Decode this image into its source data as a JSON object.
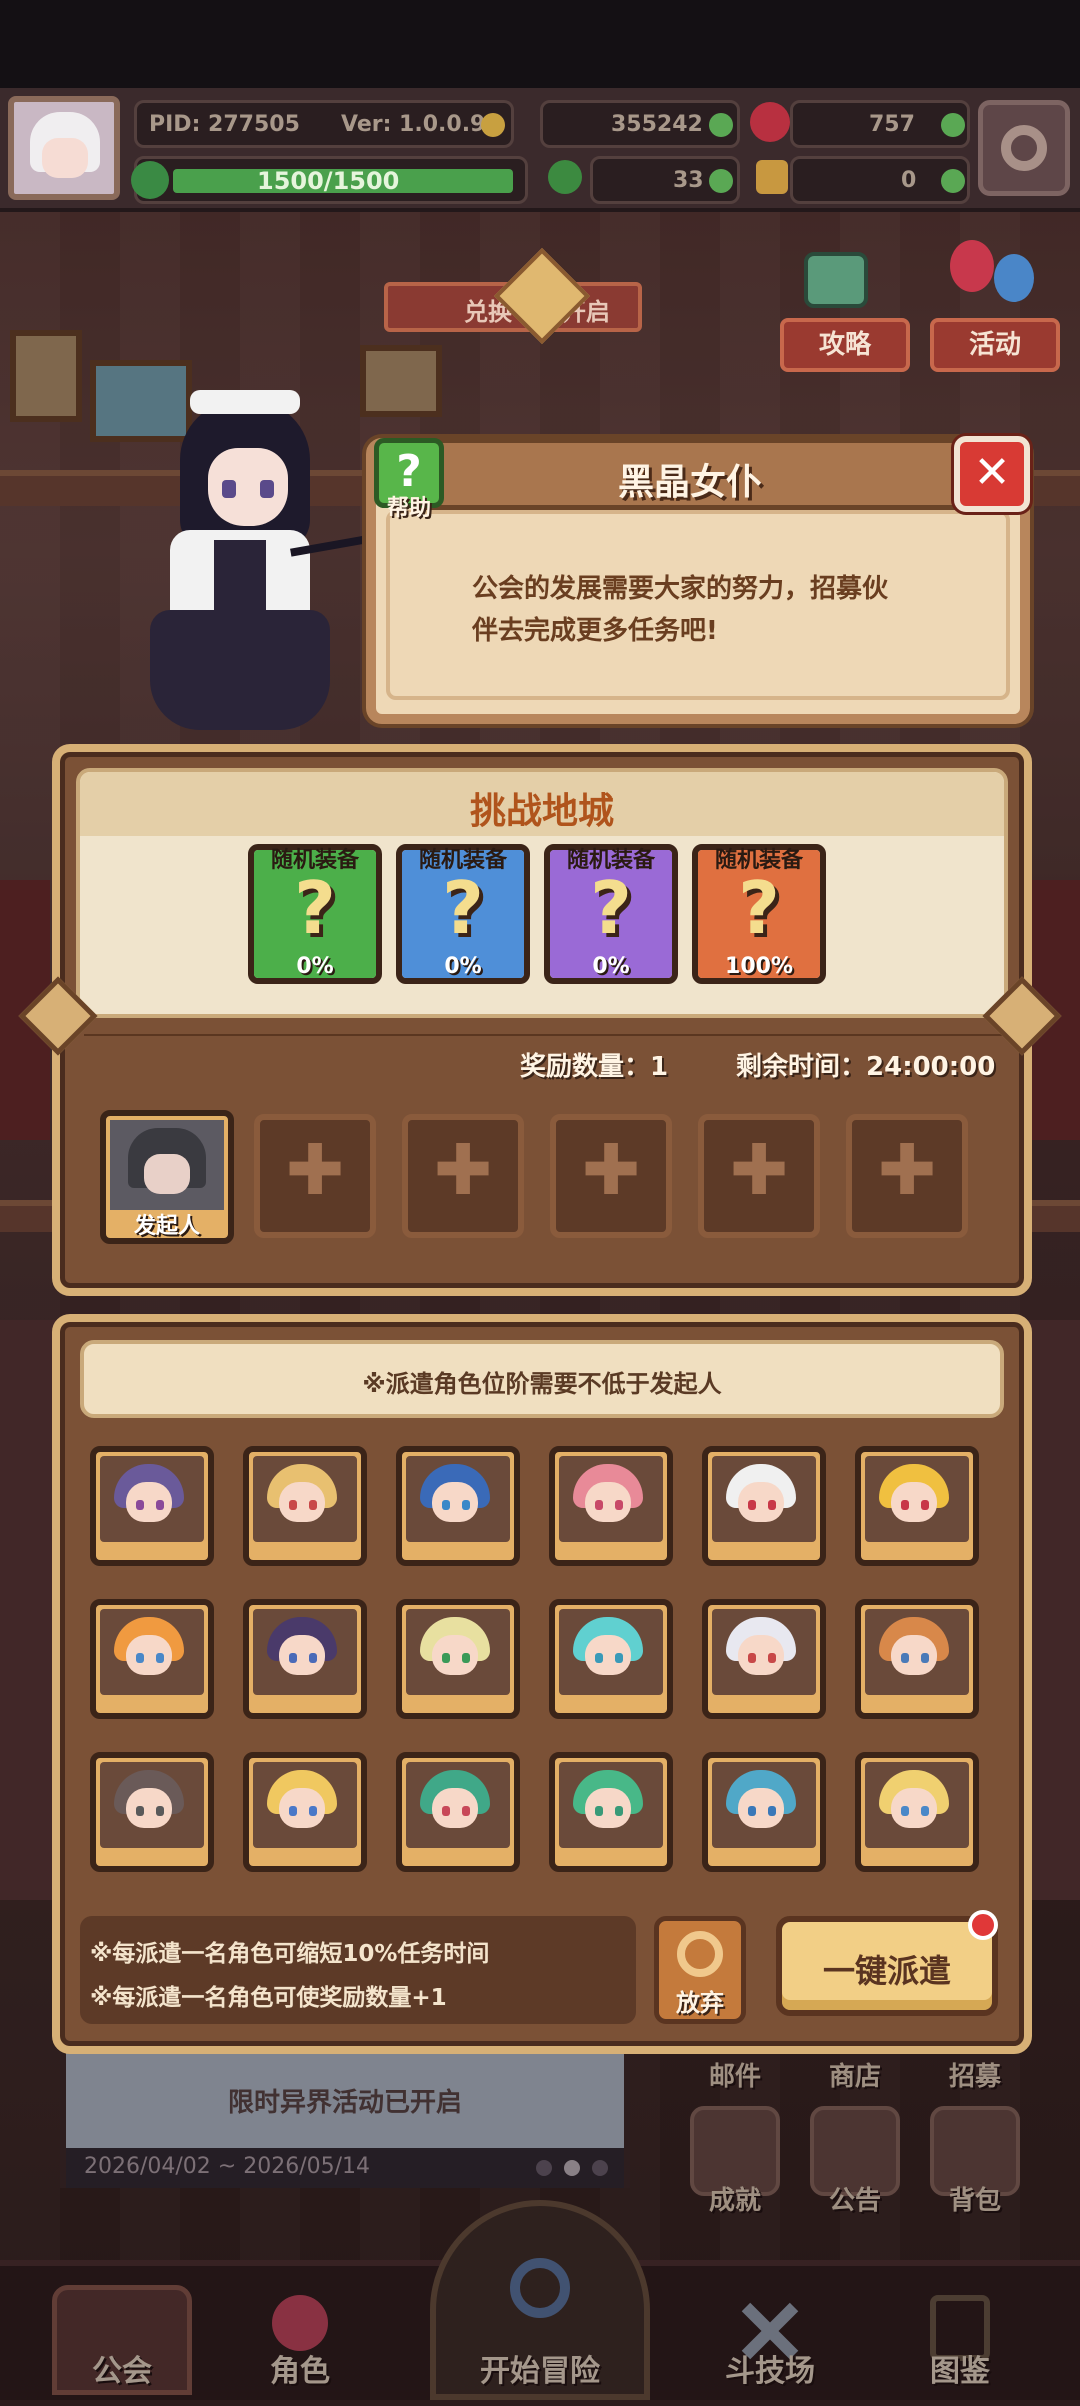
{
  "hud": {
    "pid": "PID: 277505",
    "version": "Ver: 1.0.0.9",
    "stamina": "1500/1500",
    "coins": "355242",
    "gems": "757",
    "clover": "33",
    "keys": "0"
  },
  "top_banner": {
    "text": "兑换",
    "text2": "开启"
  },
  "side_buttons": {
    "strategy": "攻略",
    "events": "活动"
  },
  "dialog": {
    "help_label": "帮助",
    "title": "黑晶女仆",
    "message": "公会的发展需要大家的努力，招募伙伴去完成更多任务吧!"
  },
  "dungeon": {
    "title": "挑战地城",
    "rewards": [
      {
        "label": "随机装备",
        "percent": "0%",
        "color": "#4caf4a"
      },
      {
        "label": "随机装备",
        "percent": "0%",
        "color": "#4f8fd8"
      },
      {
        "label": "随机装备",
        "percent": "0%",
        "color": "#9a6ad6"
      },
      {
        "label": "随机装备",
        "percent": "100%",
        "color": "#e07040"
      }
    ],
    "reward_count_label": "奖励数量：",
    "reward_count": "1",
    "time_label": "剩余时间：",
    "time_value": "24:00:00",
    "initiator_label": "发起人"
  },
  "dispatch": {
    "notice": "※派遣角色位阶需要不低于发起人",
    "tip1": "※每派遣一名角色可缩短10%任务时间",
    "tip2": "※每派遣一名角色可使奖励数量+1",
    "abandon_label": "放弃",
    "dispatch_all_label": "一键派遣"
  },
  "background_ui": {
    "mail": "邮件",
    "shop": "商店",
    "recruit": "招募",
    "achievement": "成就",
    "notice": "公告",
    "bag": "背包",
    "event_text": "限时异界活动已开启",
    "event_dates": "2026/04/02 ~ 2026/05/14"
  },
  "nav": {
    "tabs": [
      "公会",
      "角色",
      "开始冒险",
      "斗技场",
      "图鉴"
    ]
  },
  "colors": {
    "panel_border": "#d7b076",
    "panel_fill": "#7b5136",
    "cream": "#f0dfc0",
    "title_text": "#b0541c",
    "close_red": "#d83a34",
    "help_green": "#58b64a"
  }
}
